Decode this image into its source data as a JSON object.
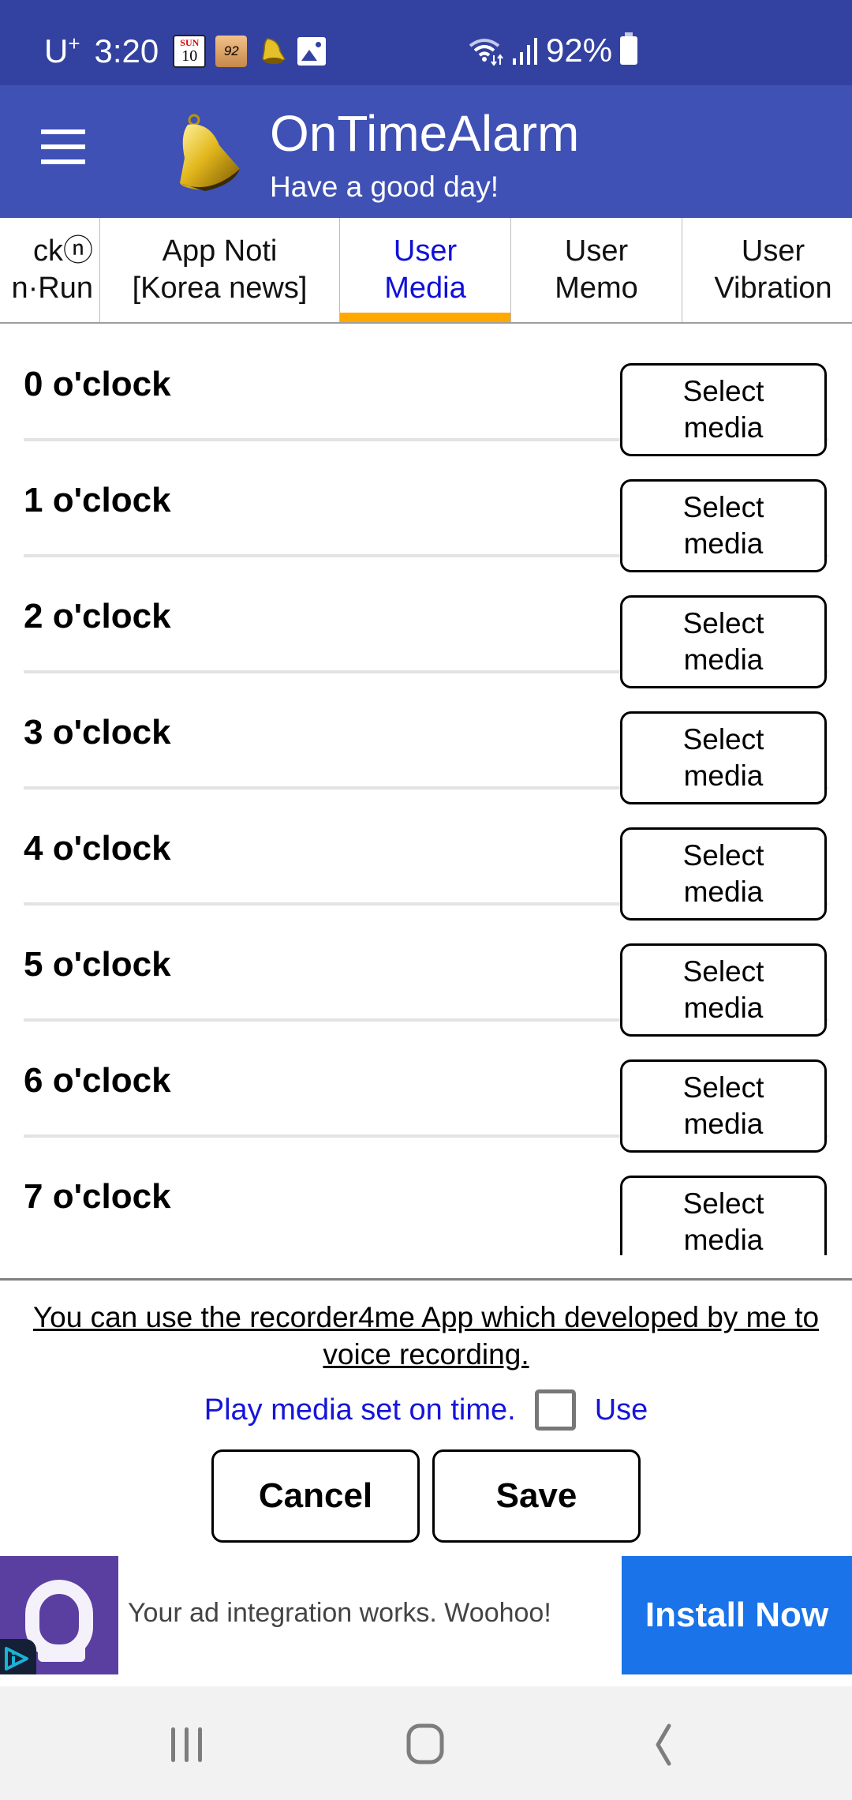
{
  "status_bar": {
    "carrier": "U",
    "carrier_sup": "+",
    "time": "3:20",
    "calendar_day_name": "SUN",
    "calendar_day_num": "10",
    "notif_badge": "92",
    "battery": "92%",
    "icons": [
      "calendar-icon",
      "badge-92-icon",
      "bell-icon",
      "image-icon",
      "wifi-icon",
      "signal-icon",
      "battery-icon"
    ]
  },
  "app_bar": {
    "title": "OnTimeAlarm",
    "subtitle": "Have a good day!"
  },
  "tabs": [
    {
      "label": "ckⓝ\nn·Run",
      "active": false
    },
    {
      "label": "App Noti\n[Korea news]",
      "active": false
    },
    {
      "label": "User\nMedia",
      "active": true
    },
    {
      "label": "User\nMemo",
      "active": false
    },
    {
      "label": "User\nVibration",
      "active": false
    }
  ],
  "hours": [
    {
      "label": "0 o'clock",
      "button": "Select\nmedia"
    },
    {
      "label": "1 o'clock",
      "button": "Select\nmedia"
    },
    {
      "label": "2 o'clock",
      "button": "Select\nmedia"
    },
    {
      "label": "3 o'clock",
      "button": "Select\nmedia"
    },
    {
      "label": "4 o'clock",
      "button": "Select\nmedia"
    },
    {
      "label": "5 o'clock",
      "button": "Select\nmedia"
    },
    {
      "label": "6 o'clock",
      "button": "Select\nmedia"
    },
    {
      "label": "7 o'clock",
      "button": "Select\nmedia"
    }
  ],
  "info": {
    "recorder_link": "You can use the recorder4me App which developed by me to voice recording.",
    "play_label": "Play media set on time.",
    "use_label": "Use",
    "use_checked": false
  },
  "actions": {
    "cancel": "Cancel",
    "save": "Save"
  },
  "ad": {
    "text": "Your ad integration works. Woohoo!",
    "cta": "Install Now"
  },
  "colors": {
    "status_bar": "#3342a0",
    "app_bar": "#3f51b5",
    "active_tab_text": "#1010d8",
    "active_tab_indicator": "#ffa800",
    "install_button": "#1a73e8"
  }
}
